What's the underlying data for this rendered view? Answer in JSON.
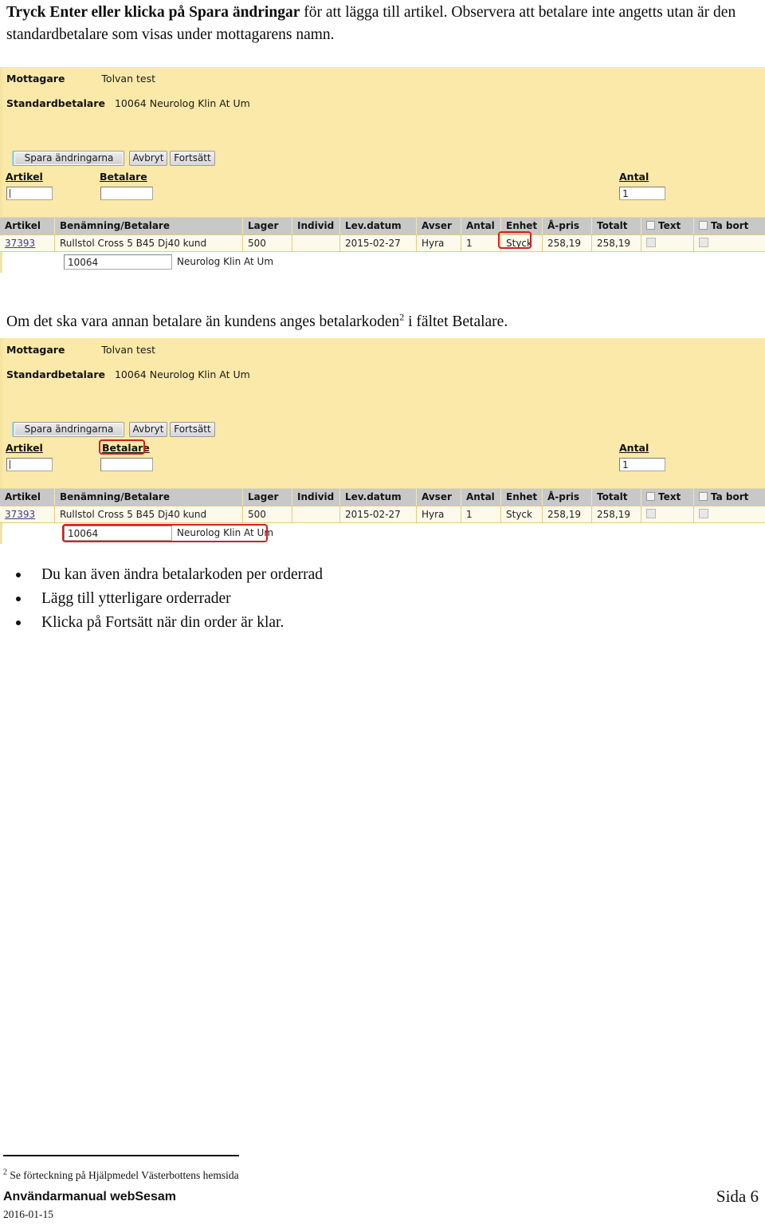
{
  "document": {
    "intro_paragraph": {
      "bold_part": "Tryck Enter eller klicka på Spara ändringar",
      "rest": " för att lägga till artikel. Observera att betalare inte angetts utan är den standardbetalare som visas under mottagarens namn."
    },
    "mid_paragraph": {
      "before_note": "Om det ska vara annan betalare än kundens anges betalarkoden",
      "note_marker": "2",
      "after_note": " i fältet Betalare."
    },
    "bullets": [
      "Du kan även ändra betalarkoden per orderrad",
      "Lägg till ytterligare orderrader",
      "Klicka på Fortsätt när din order är klar."
    ],
    "footer": {
      "footnote_marker": "2",
      "footnote_text": "Se förteckning på Hjälpmedel Västerbottens hemsida",
      "manual_title": "Användarmanual webSesam",
      "date": "2016-01-15",
      "page_label": "Sida 6"
    }
  },
  "screenshot_one": {
    "recipient_label": "Mottagare",
    "recipient_value": "Tolvan test",
    "default_payer_label": "Standardbetalare",
    "default_payer_value": "10064 Neurolog Klin At Um",
    "buttons": {
      "save": "Spara ändringarna",
      "cancel": "Avbryt",
      "continue": "Fortsätt"
    },
    "form": {
      "article_label": "Artikel",
      "article_value": "",
      "payer_label": "Betalare",
      "payer_value": "",
      "quantity_label": "Antal",
      "quantity_value": "1"
    },
    "table": {
      "headers": [
        "Artikel",
        "Benämning/Betalare",
        "Lager",
        "Individ",
        "Lev.datum",
        "Avser",
        "Antal",
        "Enhet",
        "Å-pris",
        "Totalt",
        "Text",
        "Ta bort"
      ],
      "row": {
        "artikel": "37393",
        "benamning": "Rullstol Cross 5 B45 Dj40 kund",
        "lager": "500",
        "individ": "",
        "lev_datum": "2015-02-27",
        "avser": "Hyra",
        "antal": "1",
        "enhet": "Styck",
        "a_pris": "258,19",
        "totalt": "258,19",
        "text_checked": false,
        "ta_bort_checked": false
      },
      "payer_subrow": {
        "code": "10064",
        "name": "Neurolog Klin At Um"
      }
    },
    "highlight": "enhet-cell"
  },
  "screenshot_two": {
    "recipient_label": "Mottagare",
    "recipient_value": "Tolvan test",
    "default_payer_label": "Standardbetalare",
    "default_payer_value": "10064 Neurolog Klin At Um",
    "buttons": {
      "save": "Spara ändringarna",
      "cancel": "Avbryt",
      "continue": "Fortsätt"
    },
    "form": {
      "article_label": "Artikel",
      "article_value": "",
      "payer_label": "Betalare",
      "payer_value": "",
      "quantity_label": "Antal",
      "quantity_value": "1"
    },
    "table": {
      "headers": [
        "Artikel",
        "Benämning/Betalare",
        "Lager",
        "Individ",
        "Lev.datum",
        "Avser",
        "Antal",
        "Enhet",
        "Å-pris",
        "Totalt",
        "Text",
        "Ta bort"
      ],
      "row": {
        "artikel": "37393",
        "benamning": "Rullstol Cross 5 B45 Dj40 kund",
        "lager": "500",
        "individ": "",
        "lev_datum": "2015-02-27",
        "avser": "Hyra",
        "antal": "1",
        "enhet": "Styck",
        "a_pris": "258,19",
        "totalt": "258,19",
        "text_checked": false,
        "ta_bort_checked": false
      },
      "payer_subrow": {
        "code": "10064",
        "name": "Neurolog Klin At Um"
      }
    },
    "highlights": [
      "betalare-label",
      "payer-subrow"
    ]
  },
  "colors": {
    "form_background": "#fae9a8",
    "table_header": "#c8c8c8",
    "table_row": "#fdfaec",
    "annotation_red": "#d21f1f",
    "link_blue": "#3b3b8f"
  }
}
